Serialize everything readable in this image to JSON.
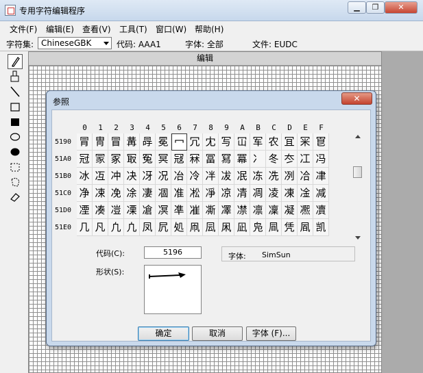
{
  "window": {
    "title": "专用字符编辑程序",
    "min_label": "▁",
    "max_label": "❐",
    "close_label": "✕"
  },
  "menu": [
    "文件(F)",
    "编辑(E)",
    "查看(V)",
    "工具(T)",
    "窗口(W)",
    "帮助(H)"
  ],
  "toolbar": {
    "charset_label": "字符集:",
    "charset_value": "ChineseGBK",
    "code_label": "代码: AAA1",
    "font_label": "字体: 全部",
    "file_label": "文件: EUDC"
  },
  "tools": [
    "pencil-icon",
    "brush-icon",
    "line-icon",
    "hollow-rect-icon",
    "filled-rect-icon",
    "hollow-ellipse-icon",
    "filled-ellipse-icon",
    "rect-select-icon",
    "freeform-select-icon",
    "eraser-icon"
  ],
  "editor": {
    "title": "编辑"
  },
  "dialog": {
    "title": "参照",
    "close_label": "✕",
    "col_headers": [
      "0",
      "1",
      "2",
      "3",
      "4",
      "5",
      "6",
      "7",
      "8",
      "9",
      "A",
      "B",
      "C",
      "D",
      "E",
      "F"
    ],
    "rows": [
      {
        "code": "5190",
        "chars": [
          "冐",
          "冑",
          "冒",
          "冓",
          "冔",
          "冕",
          "冖",
          "冗",
          "冘",
          "写",
          "冚",
          "军",
          "农",
          "冝",
          "冞",
          "冟"
        ]
      },
      {
        "code": "51A0",
        "chars": [
          "冠",
          "冡",
          "冢",
          "冣",
          "冤",
          "冥",
          "冦",
          "冧",
          "冨",
          "冩",
          "冪",
          "冫",
          "冬",
          "冭",
          "冮",
          "冯"
        ]
      },
      {
        "code": "51B0",
        "chars": [
          "冰",
          "冱",
          "冲",
          "决",
          "冴",
          "况",
          "冶",
          "冷",
          "冸",
          "冹",
          "冺",
          "冻",
          "冼",
          "冽",
          "冾",
          "冿"
        ]
      },
      {
        "code": "51C0",
        "chars": [
          "净",
          "凁",
          "凂",
          "凃",
          "凄",
          "凅",
          "准",
          "凇",
          "凈",
          "凉",
          "凊",
          "凋",
          "凌",
          "凍",
          "凎",
          "减"
        ]
      },
      {
        "code": "51D0",
        "chars": [
          "凐",
          "凑",
          "凒",
          "凓",
          "凔",
          "凕",
          "凖",
          "凗",
          "凘",
          "凙",
          "凚",
          "凛",
          "凜",
          "凝",
          "凞",
          "凟"
        ]
      },
      {
        "code": "51E0",
        "chars": [
          "几",
          "凡",
          "凢",
          "凣",
          "凤",
          "凥",
          "処",
          "凧",
          "凨",
          "凩",
          "凪",
          "凫",
          "凬",
          "凭",
          "凮",
          "凯"
        ]
      }
    ],
    "selected": {
      "row": 0,
      "col": 6
    },
    "code_label": "代码(C):",
    "code_value": "5196",
    "font_label": "字体:",
    "font_value": "SimSun",
    "shape_label": "形状(S):",
    "ok_label": "确定",
    "cancel_label": "取消",
    "font_button_label": "字体 (F)..."
  }
}
